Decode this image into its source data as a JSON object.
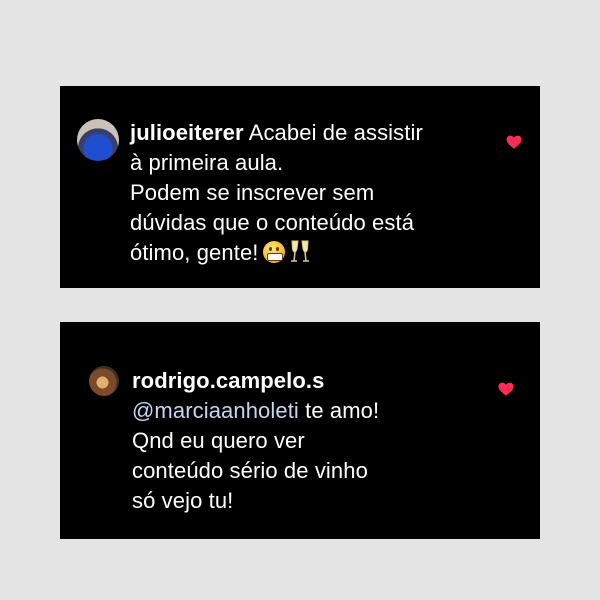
{
  "comments": [
    {
      "username": "julioeiterer",
      "text_lines": [
        "Acabei de assistir",
        "à primeira aula.",
        "Podem se inscrever sem",
        "dúvidas que o conteúdo está",
        "ótimo, gente!"
      ],
      "emojis": [
        "grinning-face-emoji",
        "clinking-glasses-emoji"
      ],
      "liked": true
    },
    {
      "username": "rodrigo.campelo.s",
      "mention": "@marciaanholeti",
      "text_lines": [
        "te amo!",
        "Qnd eu quero ver",
        "conteúdo sério de vinho",
        "só vejo tu!"
      ],
      "liked": true
    }
  ],
  "colors": {
    "background": "#e4e4e4",
    "card": "#000000",
    "text": "#ffffff",
    "heart": "#ff2d55"
  }
}
